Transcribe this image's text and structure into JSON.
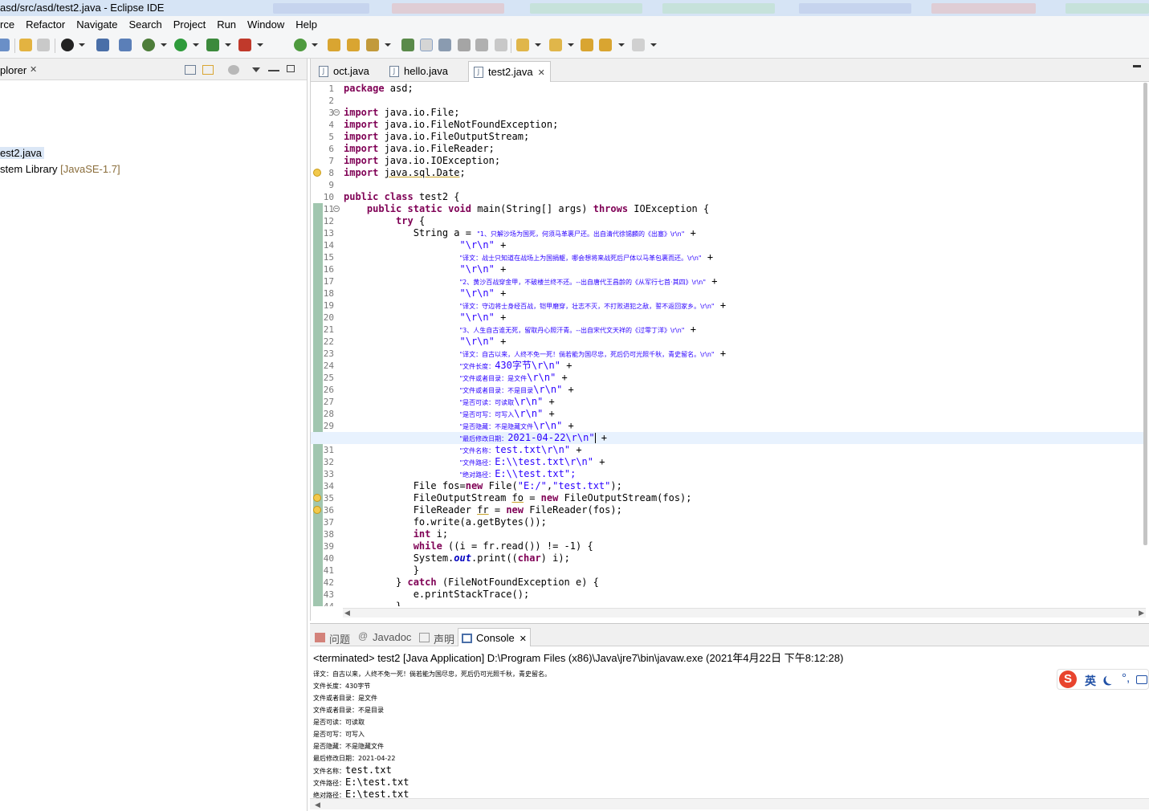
{
  "window": {
    "title": "asd/src/asd/test2.java - Eclipse IDE"
  },
  "menu": [
    "rce",
    "Refactor",
    "Navigate",
    "Search",
    "Project",
    "Run",
    "Window",
    "Help"
  ],
  "explorer": {
    "tab_label": "plorer",
    "items": [
      {
        "label": "est2.java"
      },
      {
        "label": "stem Library ",
        "tag": "[JavaSE-1.7]"
      }
    ]
  },
  "editor": {
    "tabs": [
      {
        "label": "oct.java"
      },
      {
        "label": "hello.java"
      },
      {
        "label": "test2.java",
        "active": true
      }
    ],
    "line_numbers": [
      "1",
      "2",
      "3",
      "4",
      "5",
      "6",
      "7",
      "8",
      "9",
      "10",
      "11",
      "12",
      "13",
      "14",
      "15",
      "16",
      "17",
      "18",
      "19",
      "20",
      "21",
      "22",
      "23",
      "24",
      "25",
      "26",
      "27",
      "28",
      "29",
      "30",
      "31",
      "32",
      "33",
      "34",
      "35",
      "36",
      "37",
      "38",
      "39",
      "40",
      "41",
      "42",
      "43",
      "44"
    ],
    "code": {
      "l1": "package asd;",
      "l3": "import java.io.File;",
      "l4": "import java.io.FileNotFoundException;",
      "l5": "import java.io.FileOutputStream;",
      "l6": "import java.io.FileReader;",
      "l7": "import java.io.IOException;",
      "l8a": "import ",
      "l8b": "java.sql.Date",
      "l10": "public class test2 {",
      "l11": "public static void main(String[] args) throws IOException {",
      "l12": "try {",
      "l13a": "String a = ",
      "l13b": "\"1、只解沙场为国死，何须马革裹尸还。出自清代徐锡麟的《出塞》\\r\\n\"",
      "l14": "\"\\r\\n\"",
      "l15": "\"译文：战士只知道在战场上为国捐躯，哪会想将来战死后尸体以马革包裹而还。\\r\\n\"",
      "l16": "\"\\r\\n\"",
      "l17": "\"2、黄沙百战穿金甲，不破楼兰终不还。--出自唐代王昌龄的《从军行七首·其四》\\r\\n\"",
      "l18": "\"\\r\\n\"",
      "l19": "\"译文：守边将士身经百战，铠甲磨穿，壮志不灭，不打败进犯之敌，誓不返回家乡。\\r\\n\"",
      "l20": "\"\\r\\n\"",
      "l21": "\"3、人生自古谁无死，留取丹心照汗青。--出自宋代文天祥的《过零丁洋》\\r\\n\"",
      "l22": "\"\\r\\n\"",
      "l23": "\"译文：自古以来，人终不免一死！倘若能为国尽忠，死后仍可光照千秋，青史留名。\\r\\n\"",
      "l24a": "\"文件长度：",
      "l24b": "430字节\\r\\n\"",
      "l25a": "\"文件或者目录：是文件",
      "l25b": "\\r\\n\"",
      "l26a": "\"文件或者目录：不是目录",
      "l26b": "\\r\\n\"",
      "l27a": "\"是否可读：可读取",
      "l27b": "\\r\\n\"",
      "l28a": "\"是否可写：可写入",
      "l28b": "\\r\\n\"",
      "l29a": "\"是否隐藏：不是隐藏文件",
      "l29b": "\\r\\n\"",
      "l30a": "\"最后修改日期：",
      "l30b": "2021-04-22\\r\\n\"",
      "l31a": "\"文件名称：",
      "l31b": "test.txt\\r\\n\"",
      "l32a": "\"文件路径：",
      "l32b": "E:\\\\test.txt\\r\\n\"",
      "l33a": "\"绝对路径：",
      "l33b": "E:\\\\test.txt\";",
      "l34": "File fos=new File(\"E:/\",\"test.txt\");",
      "l35": "FileOutputStream fo = new FileOutputStream(fos);",
      "l36": "FileReader fr = new FileReader(fos);",
      "l37": "fo.write(a.getBytes());",
      "l38": "int i;",
      "l39": "while ((i = fr.read()) != -1) {",
      "l40": "System.out.print((char) i);",
      "l41": "}",
      "l42": "} catch (FileNotFoundException e) {",
      "l43": "e.printStackTrace();",
      "l44": "}"
    }
  },
  "bottom": {
    "tabs": [
      {
        "label": "问题"
      },
      {
        "label": "Javadoc"
      },
      {
        "label": "声明"
      },
      {
        "label": "Console",
        "active": true
      }
    ],
    "terminated": "<terminated> test2 [Java Application] D:\\Program Files (x86)\\Java\\jre7\\bin\\javaw.exe (2021年4月22日 下午8:12:28)",
    "output": [
      {
        "label": "译文：自古以来，人终不免一死！倘若能为国尽忠，死后仍可光照千秋，青史留名。",
        "value": ""
      },
      {
        "label": "文件长度：430字节",
        "value": ""
      },
      {
        "label": "文件或者目录：是文件",
        "value": ""
      },
      {
        "label": "文件或者目录：不是目录",
        "value": ""
      },
      {
        "label": "是否可读：可读取",
        "value": ""
      },
      {
        "label": "是否可写：可写入",
        "value": ""
      },
      {
        "label": "是否隐藏：不是隐藏文件",
        "value": ""
      },
      {
        "label": "最后修改日期：2021-04-22",
        "value": ""
      },
      {
        "label": "文件名称：",
        "value": "test.txt"
      },
      {
        "label": "文件路径：",
        "value": "E:\\test.txt"
      },
      {
        "label": "绝对路径：",
        "value": "E:\\test.txt"
      }
    ]
  },
  "ime": {
    "logo": "S",
    "mode": "英",
    "punct": "°,"
  },
  "colors": {
    "keyword": "#7f0055",
    "string": "#2a00ff",
    "current_line": "#e8f2fe",
    "coverage": "#8ab89b"
  }
}
